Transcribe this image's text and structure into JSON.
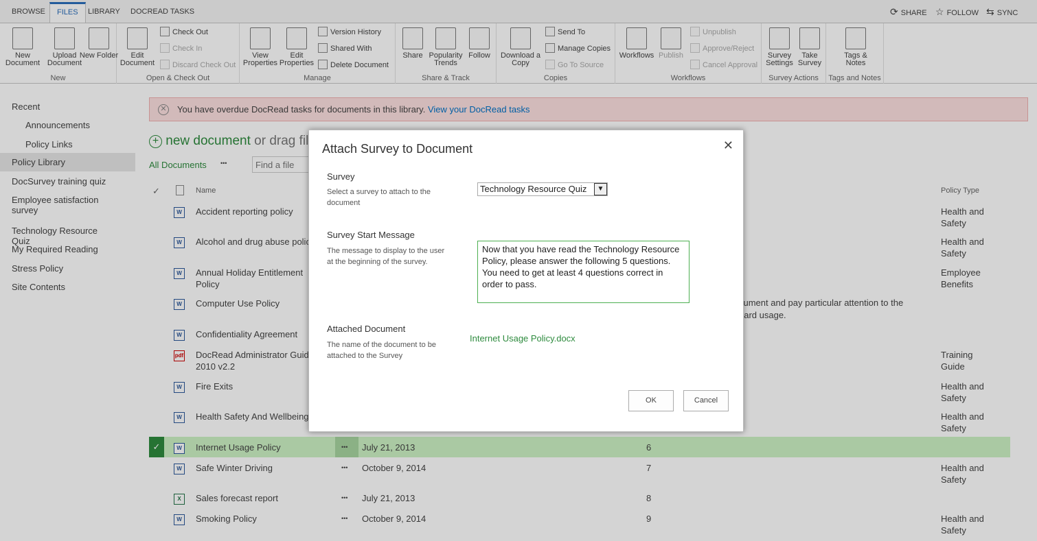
{
  "tabs": [
    "BROWSE",
    "FILES",
    "LIBRARY",
    "DOCREAD TASKS"
  ],
  "top_actions": [
    "SHARE",
    "FOLLOW",
    "SYNC"
  ],
  "ribbon": {
    "groups": [
      "New",
      "Open & Check Out",
      "Manage",
      "Share & Track",
      "Copies",
      "Workflows",
      "Survey Actions",
      "Tags and Notes"
    ],
    "big": [
      "New Document",
      "Upload Document",
      "New Folder",
      "Edit Document",
      "View Properties",
      "Edit Properties",
      "Share",
      "Popularity Trends",
      "Follow",
      "Download a Copy",
      "Workflows",
      "Publish",
      "Survey Settings",
      "Take Survey",
      "Tags & Notes"
    ],
    "small": [
      "Check Out",
      "Check In",
      "Discard Check Out",
      "Version History",
      "Shared With",
      "Delete Document",
      "Send To",
      "Manage Copies",
      "Go To Source",
      "Unpublish",
      "Approve/Reject",
      "Cancel Approval"
    ]
  },
  "nav": [
    "Recent",
    "Announcements",
    "Policy Links",
    "Policy Library",
    "DocSurvey training quiz",
    "Employee satisfaction survey",
    "Technology Resource Quiz",
    "My Required Reading",
    "Stress Policy",
    "Site Contents"
  ],
  "alert": {
    "text": "You have overdue DocRead tasks for documents in this library.",
    "link": "View your DocRead tasks"
  },
  "library": {
    "new_document": "new document",
    "drag": "or drag fil",
    "view": "All Documents",
    "ellipsis": "•••",
    "search_placeholder": "Find a file",
    "col_name": "Name",
    "col_policy_type": "Policy Type",
    "desc_fragment_1": "cument and pay particular attention to the",
    "desc_fragment_2": "oard usage."
  },
  "rows": [
    {
      "name": "Accident reporting policy",
      "type": "w",
      "date": "",
      "num": "",
      "policy": "Health and Safety"
    },
    {
      "name": "Alcohol and drug abuse polic",
      "type": "w",
      "date": "",
      "num": "",
      "policy": "Health and Safety"
    },
    {
      "name": "Annual Holiday Entitlement Policy",
      "type": "w",
      "date": "",
      "num": "",
      "policy": "Employee Benefits"
    },
    {
      "name": "Computer Use Policy",
      "type": "w",
      "date": "",
      "num": "",
      "policy": ""
    },
    {
      "name": "Confidentiality Agreement",
      "type": "w",
      "date": "",
      "num": "",
      "policy": ""
    },
    {
      "name": "DocRead Administrator Guid 2010 v2.2",
      "type": "pdf",
      "date": "",
      "num": "",
      "policy": "Training Guide"
    },
    {
      "name": "Fire Exits",
      "type": "w",
      "date": "",
      "num": "",
      "policy": "Health and Safety"
    },
    {
      "name": "Health Safety And Wellbeing",
      "type": "w",
      "date": "",
      "num": "",
      "policy": "Health and Safety"
    },
    {
      "name": "Internet Usage Policy",
      "type": "w",
      "date": "July 21, 2013",
      "num": "6",
      "policy": "",
      "selected": true
    },
    {
      "name": "Safe Winter Driving",
      "type": "w",
      "date": "October 9, 2014",
      "num": "7",
      "policy": "Health and Safety"
    },
    {
      "name": "Sales forecast report",
      "type": "x",
      "date": "July 21, 2013",
      "num": "8",
      "policy": ""
    },
    {
      "name": "Smoking Policy",
      "type": "w",
      "date": "October 9, 2014",
      "num": "9",
      "policy": "Health and Safety"
    }
  ],
  "modal": {
    "title": "Attach Survey to Document",
    "survey_label": "Survey",
    "survey_desc": "Select a survey to attach to the document",
    "survey_value": "Technology Resource Quiz",
    "msg_label": "Survey Start Message",
    "msg_desc": "The message to display to the user at the beginning of the survey.",
    "msg_value": "Now that you have read the Technology Resource Policy, please answer the following 5 questions. You need to get at least 4 questions correct in order to pass.",
    "doc_label": "Attached Document",
    "doc_desc": "The name of the document to be attached to the Survey",
    "doc_value": "Internet Usage Policy.docx",
    "ok": "OK",
    "cancel": "Cancel"
  },
  "colors": {
    "accent": "#0072c6",
    "new_doc_green": "#2e8b3e",
    "selected_row": "#cdf2c5",
    "alert_bg": "#fde0e0"
  }
}
